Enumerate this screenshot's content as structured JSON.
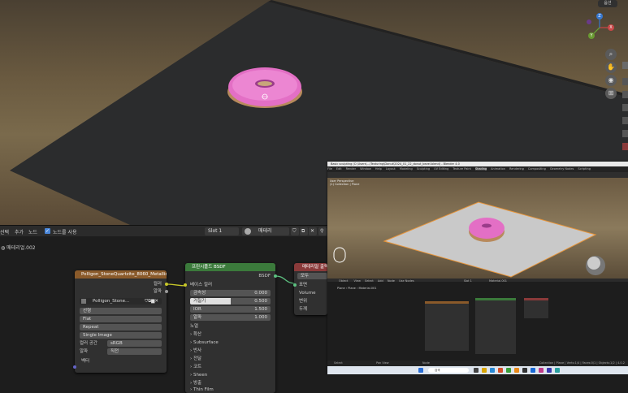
{
  "viewport": {
    "view_menu": "옵션",
    "gizmo": {
      "x": "X",
      "y": "Y",
      "z": "Z"
    }
  },
  "node_header": {
    "menu": [
      "선택",
      "추가",
      "노드"
    ],
    "use_nodes_label": "노드를 사용",
    "slot": "Slot 1",
    "material_name": "매테리얼.002"
  },
  "breadcrumb": "매테리얼.002",
  "image_node": {
    "title": "Polligon_StoneQuartzite_8060_Metallic",
    "out_color": "컬러",
    "out_alpha": "알파",
    "image_name": "Polligon_Stone...",
    "projection_label": "선형",
    "interpolation": "Flat",
    "extension": "Repeat",
    "source": "Single Image",
    "colorspace_label": "컬러 공간",
    "colorspace_value": "sRGB",
    "alpha_label": "알파",
    "alpha_value": "직전",
    "vector_label": "벡터"
  },
  "bsdf_node": {
    "title": "프린시플드 BSDF",
    "out": "BSDF",
    "base_color": "베이스 컬러",
    "metallic_label": "금속성",
    "metallic_value": "0.000",
    "roughness_label": "거칠기",
    "roughness_value": "0.500",
    "roughness_fill": 0.5,
    "ior_label": "IOR",
    "ior_value": "1.500",
    "alpha_label": "알파",
    "alpha_value": "1.000",
    "normal_label": "노멀",
    "panels": [
      "확산",
      "Subsurface",
      "반사",
      "전달",
      "코트",
      "Sheen",
      "방출",
      "Thin Film"
    ]
  },
  "output_node": {
    "title": "매테리얼 출력",
    "target": "모두",
    "surface": "표면",
    "volume": "Volume",
    "displacement": "변위",
    "thickness": "두께"
  },
  "screenshot": {
    "title": "Basic sculpting (C:\\Users\\...\\Texturing\\Donut\\2024_01_22_donut_bevel.blend) - Blender 4.0",
    "menu": [
      "File",
      "Edit",
      "Render",
      "Window",
      "Help",
      "Layout",
      "Modeling",
      "Sculpting",
      "UV Editing",
      "Texture Paint",
      "Shading",
      "Animation",
      "Rendering",
      "Compositing",
      "Geometry Nodes",
      "Scripting"
    ],
    "active_tab": "Shading",
    "view_info": [
      "User Perspective",
      "(1) Collection | Plane"
    ],
    "node_header": [
      "Object",
      "View",
      "Select",
      "Add",
      "Node"
    ],
    "use_nodes": "Use Nodes",
    "slot": "Slot 1",
    "material": "Material.001",
    "breadcrumb": [
      "Plane",
      "Plane",
      "Material.001"
    ],
    "status": [
      "Select",
      "Pan View",
      "Node"
    ],
    "taskbar_search": "검색",
    "status_right": "Collection | Plane | Verts:1/4 | Faces:0/1 | Objects:1/2 | 4.0.2"
  },
  "colors": {
    "node_green": "#3b7a3b",
    "node_brown": "#8a5a2a",
    "node_red": "#8a3a3a",
    "link_yellow": "#c7c729",
    "donut_pink": "#e36fc5"
  }
}
